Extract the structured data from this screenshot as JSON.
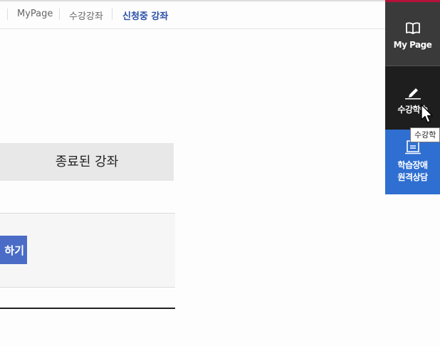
{
  "breadcrumb": {
    "items": [
      "MyPage",
      "수강강좌",
      "신청중 강좌"
    ]
  },
  "tabs": {
    "ended_course": "종료된 강좌"
  },
  "panel": {
    "action_button": "하기"
  },
  "quick_menu": {
    "mypage": "My Page",
    "study": "수강학습",
    "consult_line1": "학습장애",
    "consult_line2": "원격상담"
  },
  "tooltip": "수강학",
  "icons": {
    "mypage": "book-icon",
    "study": "pencil-icon",
    "consult": "monitor-icon",
    "cursor": "mouse-pointer-icon"
  },
  "colors": {
    "active_crumb": "#2a4ea8",
    "button_blue": "#4a6cc7",
    "quick_dark": "#3a3a3a",
    "quick_black": "#1e1e1e",
    "quick_blue": "#2f6fd1",
    "quick_accent": "#b4123a"
  }
}
